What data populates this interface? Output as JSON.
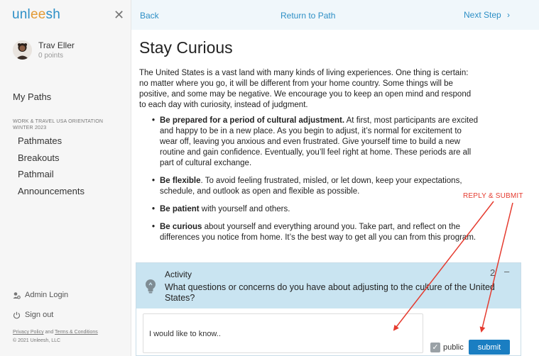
{
  "sidebar": {
    "logo": {
      "prefix": "unl",
      "accent": "ee",
      "suffix": "sh"
    },
    "close_icon": "close-icon",
    "user": {
      "name": "Trav Eller",
      "points": "0 points"
    },
    "my_paths_label": "My Paths",
    "path_title": "WORK & TRAVEL USA ORIENTATION WINTER 2023",
    "nav": [
      {
        "label": "Pathmates"
      },
      {
        "label": "Breakouts"
      },
      {
        "label": "Pathmail"
      },
      {
        "label": "Announcements"
      }
    ],
    "admin_login": "Admin Login",
    "sign_out": "Sign out",
    "footer": {
      "privacy": "Privacy Policy",
      "and": "and",
      "terms": "Terms & Conditions",
      "copyright": "© 2021 Unleesh, LLC"
    }
  },
  "topbar": {
    "back": "Back",
    "return": "Return to Path",
    "next": "Next Step",
    "next_icon": "chevron-right-icon"
  },
  "content": {
    "title": "Stay Curious",
    "intro": "The United States is a vast land with many kinds of living experiences. One thing is certain: no matter where you go, it will be different from your home country. Some things will be positive, and some may be negative. We encourage you to keep an open mind and respond to each day with curiosity, instead of judgment.",
    "bullets": [
      {
        "bold": "Be prepared for a period of cultural adjustment.",
        "text": " At first, most participants are excited and happy to be in a new place. As you begin to adjust, it’s normal for excitement to wear off, leaving you anxious and even frustrated. Give yourself time to build a new routine and gain confidence. Eventually, you’ll feel right at home. These periods are all part of cultural exchange."
      },
      {
        "bold": "Be flexible",
        "text": ". To avoid feeling frustrated, misled, or let down, keep your expectations, schedule, and outlook as open and flexible as possible."
      },
      {
        "bold": "Be patient",
        "text": " with yourself and others."
      },
      {
        "bold": "Be curious",
        "text": " about yourself and everything around you. Take part, and reflect on the differences you notice from home. It’s the best way to get all you can from this program."
      }
    ]
  },
  "activity": {
    "label": "Activity",
    "question": "What questions or concerns do you have about adjusting to the culture of the United States?",
    "head_control": "2",
    "minimize": "–",
    "answer_value": "I would like to know..",
    "public_label": "public",
    "public_checked": true,
    "submit_label": "submit"
  },
  "annotation": {
    "text": "REPLY & SUBMIT",
    "color": "#e53b2f"
  },
  "colors": {
    "brand": "#2d8fc6",
    "logo_accent": "#e39a35",
    "activity_header": "#c9e4f1",
    "submit": "#1a7ec2"
  }
}
